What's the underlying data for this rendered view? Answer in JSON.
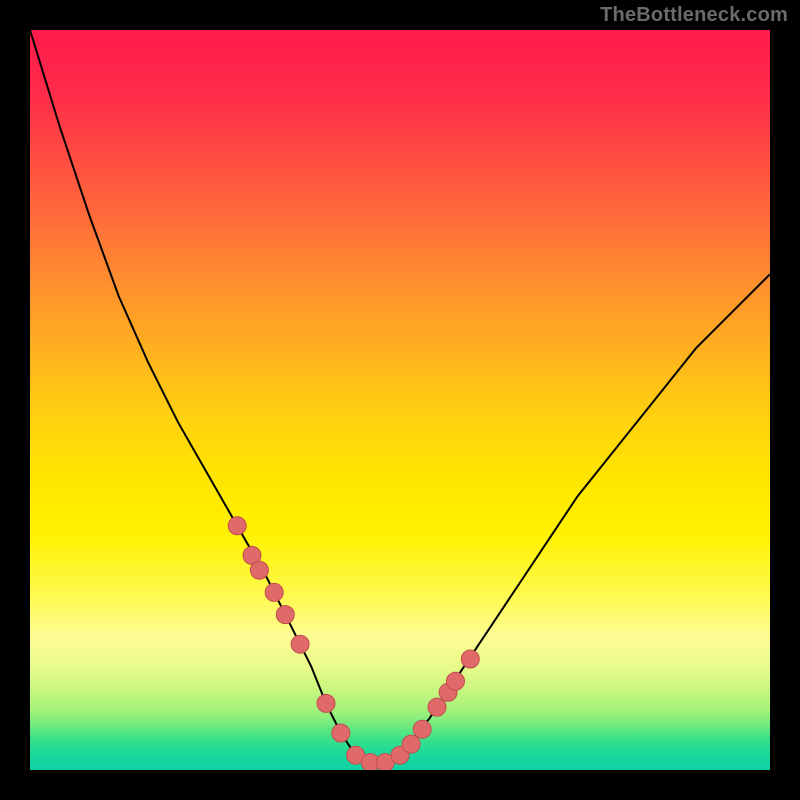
{
  "watermark": "TheBottleneck.com",
  "colors": {
    "frame": "#000000",
    "curve": "#000000",
    "marker_fill": "#e06a6a",
    "marker_stroke": "#c24d4d"
  },
  "chart_data": {
    "type": "line",
    "title": "",
    "xlabel": "",
    "ylabel": "",
    "xlim": [
      0,
      100
    ],
    "ylim": [
      0,
      100
    ],
    "grid": false,
    "legend": false,
    "series": [
      {
        "name": "bottleneck-curve",
        "x": [
          0,
          4,
          8,
          12,
          16,
          20,
          24,
          28,
          32,
          36,
          38,
          40,
          42,
          44,
          46,
          48,
          50,
          54,
          58,
          62,
          66,
          70,
          74,
          78,
          82,
          86,
          90,
          94,
          100
        ],
        "y": [
          100,
          87,
          75,
          64,
          55,
          47,
          40,
          33,
          26,
          18,
          14,
          9,
          5,
          2,
          1,
          1,
          2,
          7,
          13,
          19,
          25,
          31,
          37,
          42,
          47,
          52,
          57,
          61,
          67
        ]
      }
    ],
    "markers": {
      "name": "data-points",
      "x": [
        28,
        30,
        31,
        33,
        34.5,
        36.5,
        40,
        42,
        44,
        46,
        48,
        50,
        51.5,
        53,
        55,
        56.5,
        57.5,
        59.5
      ],
      "y": [
        33,
        29,
        27,
        24,
        21,
        17,
        9,
        5,
        2,
        1,
        1,
        2,
        3.5,
        5.5,
        8.5,
        10.5,
        12,
        15
      ]
    }
  }
}
